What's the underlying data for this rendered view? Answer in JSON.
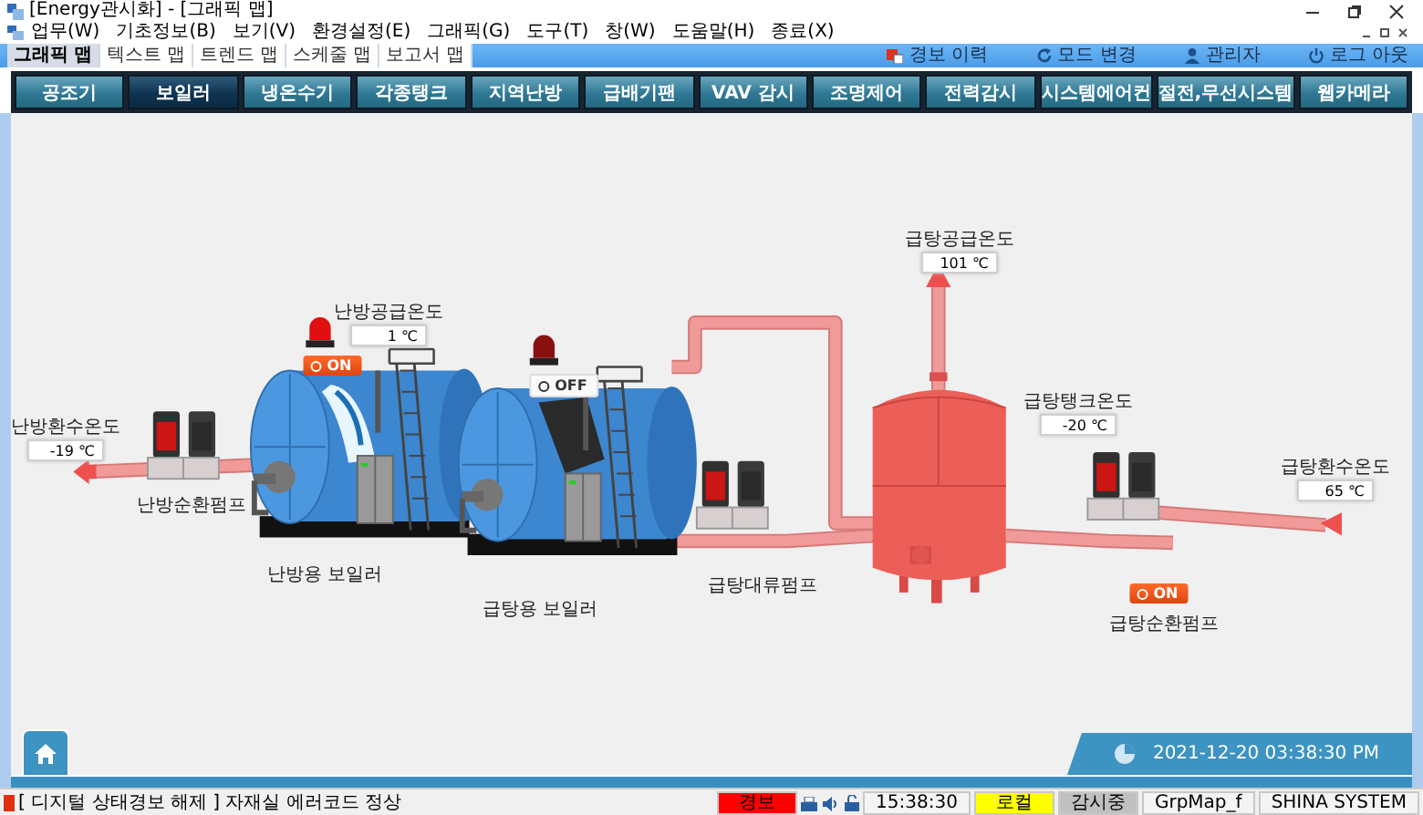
{
  "window": {
    "title": "[Energy관시화] - [그래픽 맵]"
  },
  "menu": [
    "업무(W)",
    "기초정보(B)",
    "보기(V)",
    "환경설정(E)",
    "그래픽(G)",
    "도구(T)",
    "창(W)",
    "도움말(H)",
    "종료(X)"
  ],
  "map_tabs": [
    {
      "label": "그래픽 맵",
      "selected": true
    },
    {
      "label": "텍스트 맵",
      "selected": false
    },
    {
      "label": "트렌드 맵",
      "selected": false
    },
    {
      "label": "스케줄 맵",
      "selected": false
    },
    {
      "label": "보고서 맵",
      "selected": false
    }
  ],
  "header_links": [
    {
      "kind": "alarm",
      "label": "경보 이력"
    },
    {
      "kind": "mode",
      "label": "모드 변경"
    },
    {
      "kind": "user",
      "label": "관리자"
    },
    {
      "kind": "logout",
      "label": "로그 아웃"
    }
  ],
  "nav": [
    {
      "label": "공조기",
      "selected": false
    },
    {
      "label": "보일러",
      "selected": true
    },
    {
      "label": "냉온수기",
      "selected": false
    },
    {
      "label": "각종탱크",
      "selected": false
    },
    {
      "label": "지역난방",
      "selected": false
    },
    {
      "label": "급배기팬",
      "selected": false
    },
    {
      "label": "VAV 감시",
      "selected": false
    },
    {
      "label": "조명제어",
      "selected": false
    },
    {
      "label": "전력감시",
      "selected": false
    },
    {
      "label": "시스템에어컨",
      "selected": false
    },
    {
      "label": "절전,무선시스템",
      "selected": false
    },
    {
      "label": "웹카메라",
      "selected": false
    }
  ],
  "diagram": {
    "sensors": [
      {
        "label": "난방환수온도",
        "value": "-19 ℃"
      },
      {
        "label": "난방공급온도",
        "value": "1 ℃"
      },
      {
        "label": "급탕공급온도",
        "value": "101 ℃"
      },
      {
        "label": "급탕탱크온도",
        "value": "-20 ℃"
      },
      {
        "label": "급탕환수온도",
        "value": "65 ℃"
      }
    ],
    "boilers": [
      {
        "name": "난방용 보일러",
        "status": "ON",
        "on": true
      },
      {
        "name": "급탕용 보일러",
        "status": "OFF",
        "on": false
      }
    ],
    "pumps": [
      {
        "name": "난방순환펌프"
      },
      {
        "name": "급탕대류펌프"
      },
      {
        "name": "급탕순환펌프",
        "status": "ON",
        "on": true
      }
    ]
  },
  "datetime": "2021-12-20 03:38:30 PM",
  "status_bar": {
    "message": "[ 디지털 상태경보 해제 ] 자재실 에러코드 정상",
    "cells": [
      {
        "text": "경보",
        "color": "#ff0000"
      },
      {
        "text": "15:38:30"
      },
      {
        "text": "로컬",
        "color": "#ffff00"
      },
      {
        "text": "감시중",
        "color": "#c0c0c0"
      },
      {
        "text": "GrpMap_f"
      },
      {
        "text": "SHINA SYSTEM"
      }
    ]
  }
}
